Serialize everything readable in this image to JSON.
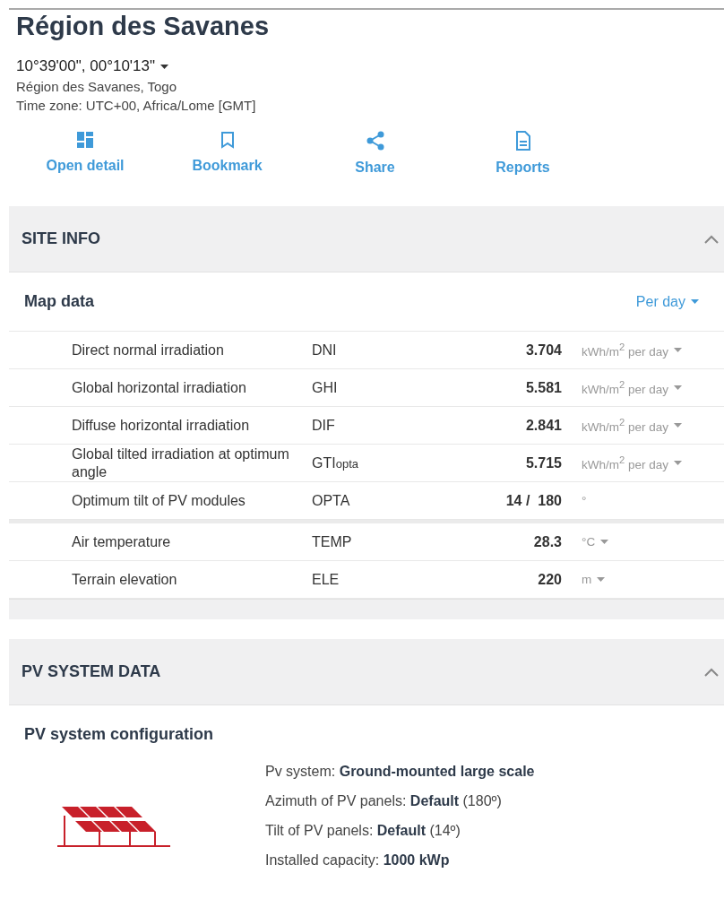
{
  "title": "Région des Savanes",
  "coordinates": "10°39'00\", 00°10'13\"",
  "coordinates_menu": true,
  "location": "Région des Savanes, Togo",
  "timezone": "Time zone: UTC+00, Africa/Lome [GMT]",
  "actions": [
    {
      "kind": "dashboard",
      "label": "Open detail"
    },
    {
      "kind": "bookmark",
      "label": "Bookmark"
    },
    {
      "kind": "share",
      "label": "Share"
    },
    {
      "kind": "document",
      "label": "Reports"
    }
  ],
  "site_info": {
    "title": "SITE INFO",
    "expanded": true,
    "subtitle": "Map data",
    "period": "Per day",
    "groups": [
      [
        {
          "name": "Direct normal irradiation",
          "abbr": "DNI",
          "value": "3.704",
          "unit": "kWh/m$^{2}$ per day",
          "unit_menu": true
        },
        {
          "name": "Global horizontal irradiation",
          "abbr": "GHI",
          "value": "5.581",
          "unit": "kWh/m$^{2}$ per day",
          "unit_menu": true
        },
        {
          "name": "Diffuse horizontal irradiation",
          "abbr": "DIF",
          "value": "2.841",
          "unit": "kWh/m$^{2}$ per day",
          "unit_menu": true
        },
        {
          "name": "Global tilted irradiation at optimum angle",
          "abbr": "GTI",
          "abbr_sub": "opta",
          "value": "5.715",
          "unit": "kWh/m$^{2}$ per day",
          "unit_menu": true
        },
        {
          "name": "Optimum tilt of PV modules",
          "abbr": "OPTA",
          "value": "14 /  180",
          "unit": "°",
          "unit_menu": false
        }
      ],
      [
        {
          "name": "Air temperature",
          "abbr": "TEMP",
          "value": "28.3",
          "unit": "°C",
          "unit_menu": true
        },
        {
          "name": "Terrain elevation",
          "abbr": "ELE",
          "value": "220",
          "unit": "m",
          "unit_menu": true
        }
      ]
    ]
  },
  "pv_system": {
    "title": "PV SYSTEM DATA",
    "expanded": true,
    "subtitle": "PV system configuration",
    "details": [
      "Pv system: **Ground-mounted large scale**",
      "Azimuth of PV panels: **Default** (180º)",
      "Tilt of PV panels: **Default** (14º)",
      "Installed capacity: **1000 kWp**"
    ]
  }
}
